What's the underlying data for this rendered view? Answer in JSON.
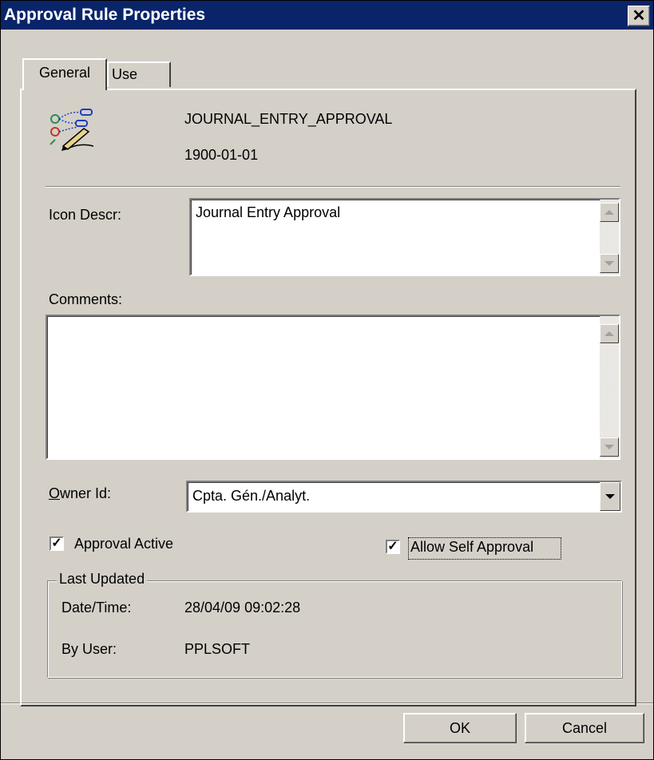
{
  "window": {
    "title": "Approval Rule Properties",
    "close_symbol": "✕"
  },
  "tabs": [
    {
      "label": "General",
      "selected": true
    },
    {
      "label": "Use",
      "selected": false
    }
  ],
  "header": {
    "rule_id": "JOURNAL_ENTRY_APPROVAL",
    "effective_date": "1900-01-01",
    "icon": "approval-rule-icon"
  },
  "form": {
    "icon_descr_label": "Icon Descr:",
    "icon_descr_value": "Journal Entry Approval",
    "comments_label": "Comments:",
    "comments_value": "",
    "owner_label": "Owner Id:",
    "owner_accesskey": "O",
    "owner_label_rest": "wner Id:",
    "owner_value": "Cpta. Gén./Analyt.",
    "approval_active_label": "Approval Active",
    "approval_active_checked": true,
    "allow_self_approval_label": "Allow Self Approval",
    "allow_self_approval_checked": true
  },
  "last_updated": {
    "legend": "Last Updated",
    "datetime_label": "Date/Time:",
    "datetime_value": "28/04/09 09:02:28",
    "by_user_label": "By User:",
    "by_user_value": "PPLSOFT"
  },
  "buttons": {
    "ok": "OK",
    "cancel": "Cancel"
  },
  "colors": {
    "titlebar": "#0a246a",
    "face": "#d4d0c8"
  }
}
